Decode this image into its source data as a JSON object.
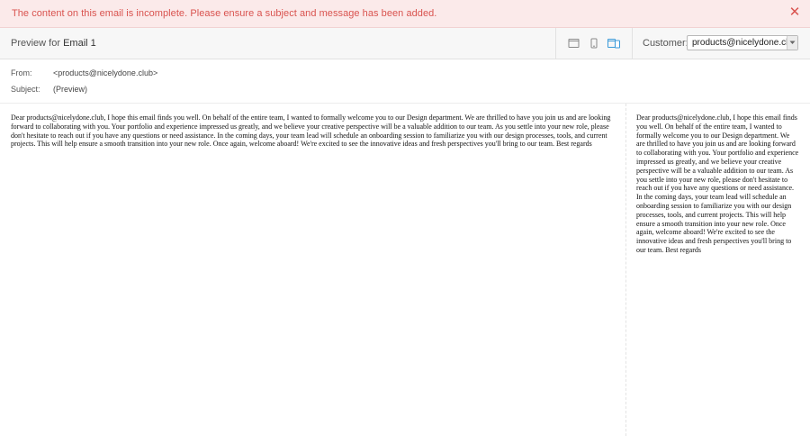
{
  "alert": {
    "message": "The content on this email is incomplete. Please ensure a subject and message has been added.",
    "close_icon": "close-icon",
    "color": "#d9534f",
    "background": "#fbeaea"
  },
  "toolbar": {
    "preview_prefix": "Preview for",
    "email_name": "Email 1",
    "view_icons": [
      "desktop-view-icon",
      "mobile-view-icon",
      "split-view-icon"
    ],
    "active_view": "split-view-icon",
    "accent": "#3a9ad9",
    "customer_label": "Customer:",
    "customer_value": "products@nicelydone.club"
  },
  "meta": {
    "from_label": "From:",
    "from_value": "<products@nicelydone.club>",
    "subject_label": "Subject:",
    "subject_value": "(Preview)"
  },
  "email": {
    "body": "Dear products@nicelydone.club, I hope this email finds you well. On behalf of the entire team, I wanted to formally welcome you to our Design department. We are thrilled to have you join us and are looking forward to collaborating with you. Your portfolio and experience impressed us greatly, and we believe your creative perspective will be a valuable addition to our team. As you settle into your new role, please don't hesitate to reach out if you have any questions or need assistance. In the coming days, your team lead will schedule an onboarding session to familiarize you with our design processes, tools, and current projects. This will help ensure a smooth transition into your new role. Once again, welcome aboard! We're excited to see the innovative ideas and fresh perspectives you'll bring to our team. Best regards"
  }
}
